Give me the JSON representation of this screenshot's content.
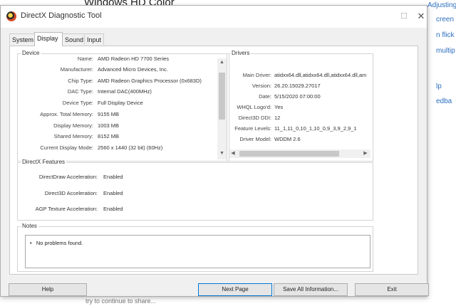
{
  "background": {
    "heading": "Windows HD Color",
    "links": [
      "Adjusting font si",
      "creen",
      "n flick",
      "multip",
      "lp",
      "edba"
    ],
    "bottom_text": "try to continue to share..."
  },
  "window": {
    "title": "DirectX Diagnostic Tool",
    "maximize_glyph": "☐",
    "close_glyph": "✕"
  },
  "tabs": [
    {
      "label": "System",
      "active": false
    },
    {
      "label": "Display",
      "active": true
    },
    {
      "label": "Sound",
      "active": false
    },
    {
      "label": "Input",
      "active": false
    }
  ],
  "device": {
    "title": "Device",
    "rows": [
      {
        "label": "Name:",
        "value": "AMD Radeon HD 7700 Series"
      },
      {
        "label": "Manufacturer:",
        "value": "Advanced Micro Devices, Inc."
      },
      {
        "label": "Chip Type:",
        "value": "AMD Radeon Graphics Processor (0x683D)"
      },
      {
        "label": "DAC Type:",
        "value": "Internal DAC(400MHz)"
      },
      {
        "label": "Device Type:",
        "value": "Full Display Device"
      },
      {
        "label": "Approx. Total Memory:",
        "value": "9155 MB"
      },
      {
        "label": "Display Memory:",
        "value": "1003 MB"
      },
      {
        "label": "Shared Memory:",
        "value": "8152 MB"
      },
      {
        "label": "Current Display Mode:",
        "value": "2560 x 1440 (32 bit) (60Hz)"
      }
    ]
  },
  "drivers": {
    "title": "Drivers",
    "rows": [
      {
        "label": "Main Driver:",
        "value": "atidxx64.dll,atidxx64.dll,atidxx64.dll,am"
      },
      {
        "label": "Version:",
        "value": "26.20.15029.27017"
      },
      {
        "label": "Date:",
        "value": "5/15/2020 07:00:00"
      },
      {
        "label": "WHQL Logo'd:",
        "value": "Yes"
      },
      {
        "label": "Direct3D DDI:",
        "value": "12"
      },
      {
        "label": "Feature Levels:",
        "value": "11_1,11_0,10_1,10_0,9_3,9_2,9_1"
      },
      {
        "label": "Driver Model:",
        "value": "WDDM 2.6"
      }
    ]
  },
  "features": {
    "title": "DirectX Features",
    "rows": [
      {
        "label": "DirectDraw Acceleration:",
        "value": "Enabled"
      },
      {
        "label": "Direct3D Acceleration:",
        "value": "Enabled"
      },
      {
        "label": "AGP Texture Acceleration:",
        "value": "Enabled"
      }
    ]
  },
  "notes": {
    "title": "Notes",
    "items": [
      "No problems found."
    ]
  },
  "buttons": {
    "help": "Help",
    "next_page": "Next Page",
    "save_all": "Save All Information...",
    "exit": "Exit"
  }
}
